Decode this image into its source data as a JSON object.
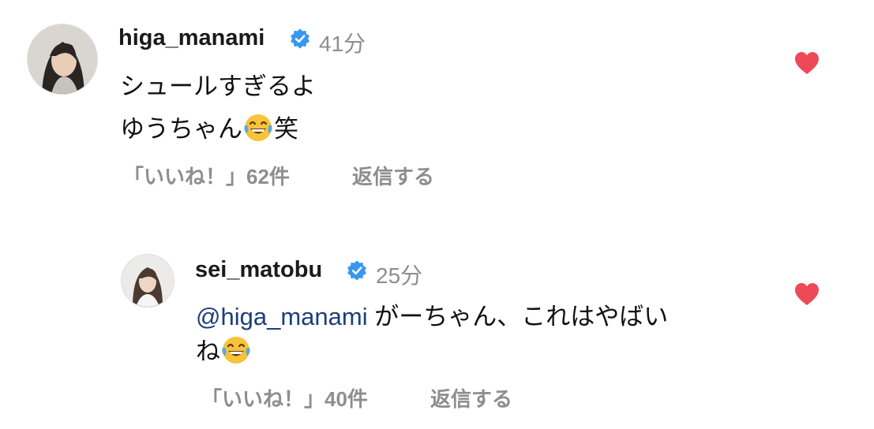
{
  "comments": [
    {
      "username": "higa_manami",
      "time": "41分",
      "lines": [
        "シュールすぎるよ",
        "ゆうちゃん",
        "笑"
      ],
      "likes_label": "「いいね！」62件",
      "reply_label": "返信する",
      "liked": true,
      "emoji_icon": "face-with-tears-of-joy-icon"
    },
    {
      "username": "sei_matobu",
      "time": "25分",
      "mention": "@higa_manami",
      "lines": [
        "がーちゃん、これはやばい",
        "ね"
      ],
      "likes_label": "「いいね！」40件",
      "reply_label": "返信する",
      "liked": true,
      "emoji_icon": "face-with-tears-of-joy-icon"
    }
  ],
  "colors": {
    "verified": "#3897f0",
    "heart": "#ed4956",
    "secondary_text": "#8e8e8e",
    "mention": "#1d3e7a"
  }
}
